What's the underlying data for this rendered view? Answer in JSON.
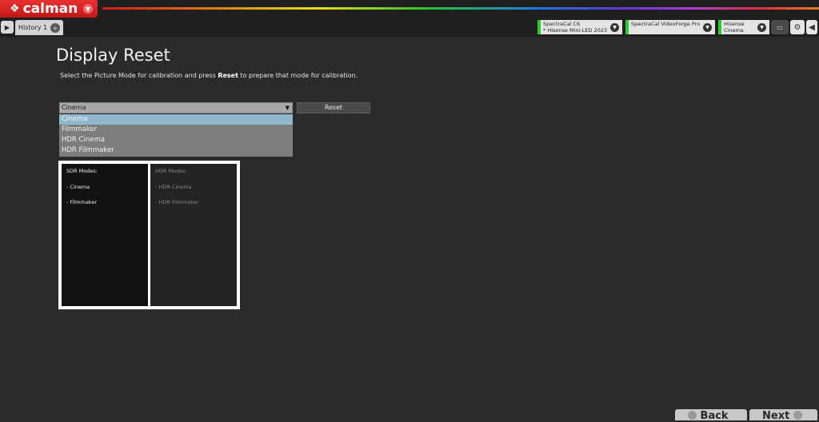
{
  "app": {
    "logo_text": "calman",
    "logo_mark": "❖",
    "menu_icon": "chevron-down-icon"
  },
  "tabs": {
    "history_label": "History 1"
  },
  "devices": [
    {
      "line1": "SpectraCal C6",
      "line2": "* Hisense Mini-LED 2023"
    },
    {
      "line1": "SpectraCal VideoForge Pro",
      "line2": ""
    },
    {
      "line1": "Hisense",
      "line2": "Cinema"
    }
  ],
  "page": {
    "title": "Display Reset",
    "desc_before": "Select the Picture Mode for calibration and press ",
    "desc_bold": "Reset",
    "desc_after": " to prepare that mode for calibration."
  },
  "picture_mode": {
    "selected": "Cinema",
    "options": [
      "Cinema",
      "Filmmaker",
      "HDR Cinema",
      "HDR Filmmaker"
    ]
  },
  "reset_label": "Reset",
  "modes": {
    "sdr_title": "SDR Modes:",
    "sdr_items": [
      "- Cinema",
      "- Filmmaker"
    ],
    "hdr_title": "HDR Modes:",
    "hdr_items": [
      "- HDR Cinema",
      "- HDR Filmmaker"
    ]
  },
  "nav": {
    "back_label": "Back",
    "next_label": "Next"
  },
  "colors": {
    "brand_red": "#d42526",
    "device_indicator": "#2ccc2c",
    "selection": "#8fb8cf"
  }
}
